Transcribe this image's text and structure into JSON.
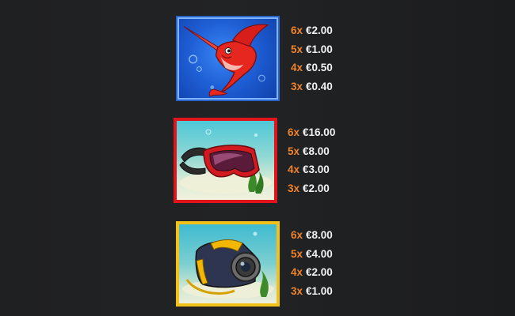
{
  "currency": "€",
  "colors": {
    "multiplier": "#f0842a",
    "amount": "#f2f2f2",
    "background": "#202123"
  },
  "symbols": [
    {
      "icon": "swordfish-icon",
      "frame_color": "#2a63c9",
      "payouts": [
        {
          "mult": "6x",
          "amount": "€2.00"
        },
        {
          "mult": "5x",
          "amount": "€1.00"
        },
        {
          "mult": "4x",
          "amount": "€0.50"
        },
        {
          "mult": "3x",
          "amount": "€0.40"
        }
      ]
    },
    {
      "icon": "diving-goggles-icon",
      "frame_color": "#e1141b",
      "payouts": [
        {
          "mult": "6x",
          "amount": "€16.00"
        },
        {
          "mult": "5x",
          "amount": "€8.00"
        },
        {
          "mult": "4x",
          "amount": "€3.00"
        },
        {
          "mult": "3x",
          "amount": "€2.00"
        }
      ]
    },
    {
      "icon": "underwater-camera-icon",
      "frame_color": "#f2c21b",
      "payouts": [
        {
          "mult": "6x",
          "amount": "€8.00"
        },
        {
          "mult": "5x",
          "amount": "€4.00"
        },
        {
          "mult": "4x",
          "amount": "€2.00"
        },
        {
          "mult": "3x",
          "amount": "€1.00"
        }
      ]
    }
  ]
}
